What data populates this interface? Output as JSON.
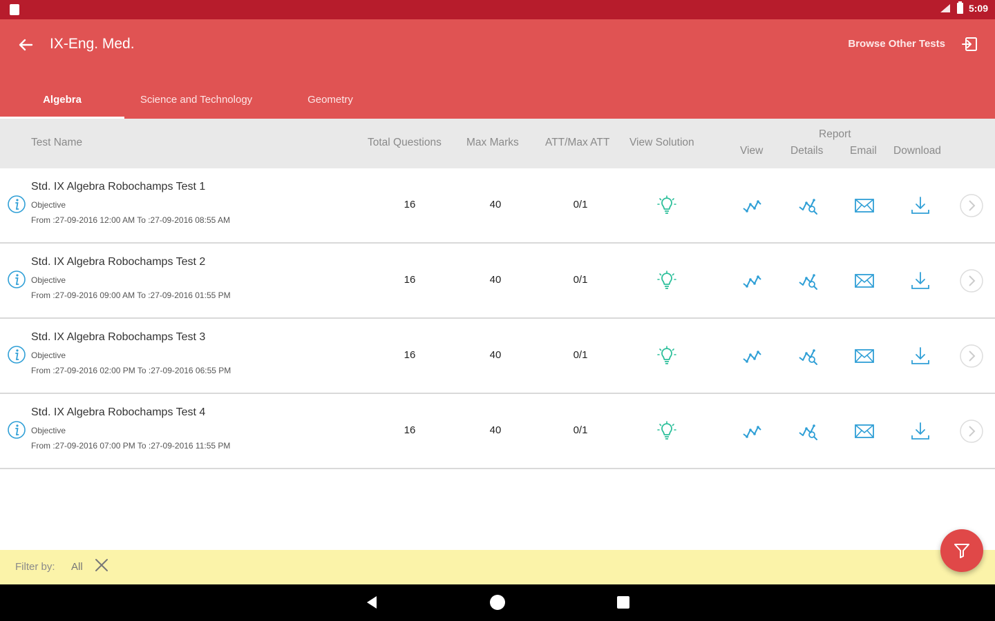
{
  "status_bar": {
    "time": "5:09"
  },
  "app_bar": {
    "title": "IX-Eng. Med.",
    "browse_label": "Browse Other Tests"
  },
  "tabs": [
    {
      "label": "Algebra",
      "active": true
    },
    {
      "label": "Science and Technology",
      "active": false
    },
    {
      "label": "Geometry",
      "active": false
    }
  ],
  "table": {
    "headers": {
      "test_name": "Test Name",
      "total_questions": "Total Questions",
      "max_marks": "Max Marks",
      "att": "ATT/Max ATT",
      "view_solution": "View Solution",
      "report": "Report",
      "view": "View",
      "details": "Details",
      "email": "Email",
      "download": "Download"
    },
    "rows": [
      {
        "name": "Std. IX Algebra Robochamps Test 1",
        "type": "Objective",
        "dates": "From :27-09-2016 12:00 AM  To :27-09-2016 08:55 AM",
        "total_questions": "16",
        "max_marks": "40",
        "att": "0/1"
      },
      {
        "name": "Std. IX Algebra Robochamps Test 2",
        "type": "Objective",
        "dates": "From :27-09-2016 09:00 AM  To :27-09-2016 01:55 PM",
        "total_questions": "16",
        "max_marks": "40",
        "att": "0/1"
      },
      {
        "name": "Std. IX Algebra Robochamps Test 3",
        "type": "Objective",
        "dates": "From :27-09-2016 02:00 PM  To :27-09-2016 06:55 PM",
        "total_questions": "16",
        "max_marks": "40",
        "att": "0/1"
      },
      {
        "name": "Std. IX Algebra Robochamps Test 4",
        "type": "Objective",
        "dates": "From :27-09-2016 07:00 PM  To :27-09-2016 11:55 PM",
        "total_questions": "16",
        "max_marks": "40",
        "att": "0/1"
      }
    ]
  },
  "filter": {
    "label": "Filter by:",
    "value": "All"
  },
  "icons": {
    "solution": "lightbulb-icon",
    "view": "chart-line-icon",
    "details": "chart-details-icon",
    "email": "envelope-icon",
    "download": "download-icon",
    "next": "chevron-right-icon"
  },
  "colors": {
    "status_bar": "#b71c2c",
    "app_bar": "#e05353",
    "accent_blue": "#2f9fd6",
    "accent_green": "#2bbf9a",
    "filter_bar": "#fbf3a9",
    "fab": "#e04848"
  }
}
